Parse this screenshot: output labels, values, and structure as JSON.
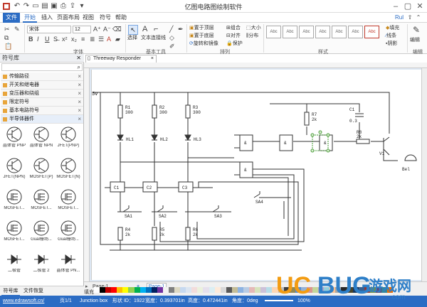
{
  "app": {
    "title": "亿图电路图绘制软件"
  },
  "user": {
    "label": "Rul"
  },
  "menu": [
    "文件",
    "开始",
    "插入",
    "页面布局",
    "视图",
    "符号",
    "帮助"
  ],
  "ribbon": {
    "font_name": "宋体",
    "font_size": "12",
    "groups": {
      "font": "字体",
      "tools": "基本工具",
      "arrange": "排列",
      "style": "样式",
      "edit": "编辑"
    },
    "tools": {
      "select": "选择",
      "text": "文本",
      "connector": "连接线"
    },
    "arrange": {
      "front": "置于顶层",
      "back": "置于底层",
      "rotate": "旋转和镜像",
      "group": "组合",
      "align": "对齐",
      "size": "大小",
      "distribute": "分布",
      "protect": "保护"
    },
    "style_swatch": "Abc",
    "fill": "填充",
    "line": "线条",
    "shadow": "阴影",
    "edit": "编辑"
  },
  "sidebar": {
    "title": "符号库",
    "libraries": [
      "传输路径",
      "开关和继电器",
      "变压器和绕组",
      "限定符号",
      "基本电路符号",
      "半导体器件"
    ],
    "symbols": [
      "晶体管 PNP",
      "晶体管 NPN",
      "JFET(PNP)",
      "JFET(NPN)",
      "MOSFET(P)",
      "MOSFET(N)",
      "MOSFET...",
      "MOSFET...",
      "MOSFET...",
      "MOSFET...",
      "Gual栅场...",
      "Gual栅场...",
      "二极管",
      "二极管 2",
      "晶体管 PN..."
    ],
    "tabs": [
      "符号库",
      "文件恢复"
    ]
  },
  "document": {
    "tab": "Threeway Responder"
  },
  "circuit": {
    "supply": "5v",
    "resistors": [
      {
        "ref": "R1",
        "val": "300"
      },
      {
        "ref": "R2",
        "val": "300"
      },
      {
        "ref": "R3",
        "val": "300"
      },
      {
        "ref": "R4",
        "val": "2k"
      },
      {
        "ref": "R5",
        "val": "2k"
      },
      {
        "ref": "R6",
        "val": "2k"
      },
      {
        "ref": "R7",
        "val": "2k"
      },
      {
        "ref": "R8",
        "val": "2k"
      }
    ],
    "leds": [
      "HL1",
      "HL2",
      "HL3"
    ],
    "latches": [
      "C1",
      "C2",
      "C3"
    ],
    "switches": [
      "SA1",
      "SA2",
      "SA3",
      "SA4"
    ],
    "gate": "&",
    "capacitor": {
      "ref": "C1",
      "val": "0.3"
    },
    "transistor": "V1",
    "bell": "Bel"
  },
  "pages": {
    "left": "Page-1",
    "add": "+",
    "current": "Page-1"
  },
  "fill_label": "填充",
  "status": {
    "url": "www.edrawsoft.cn/",
    "page": "页1/1",
    "shape": "Junction box",
    "id": "形状 ID：1922",
    "width": "宽度：0.393701in",
    "height": "高度：0.472441in",
    "angle": "角度：0deg",
    "zoom": "100%"
  },
  "watermark": {
    "uc": "UC",
    "bug": "BUG",
    "cn": "游戏网",
    "site": ".com"
  },
  "colors": {
    "accent": "#2b6cc4",
    "status": "#2b6cc4",
    "canvas": "#dde7f3"
  }
}
